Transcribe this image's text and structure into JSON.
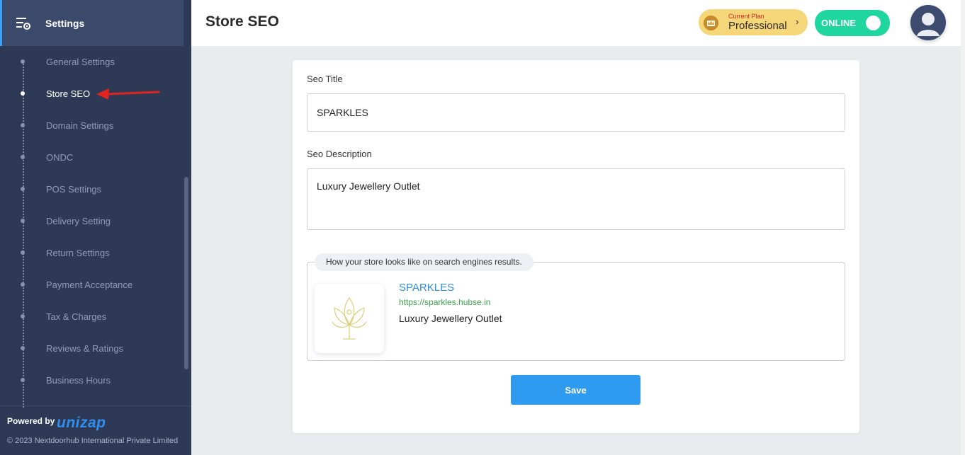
{
  "sidebar": {
    "title": "Settings",
    "items": [
      {
        "label": "General Settings"
      },
      {
        "label": "Store SEO"
      },
      {
        "label": "Domain Settings"
      },
      {
        "label": "ONDC"
      },
      {
        "label": "POS Settings"
      },
      {
        "label": "Delivery Setting"
      },
      {
        "label": "Return Settings"
      },
      {
        "label": "Payment Acceptance"
      },
      {
        "label": "Tax & Charges"
      },
      {
        "label": "Reviews & Ratings"
      },
      {
        "label": "Business Hours"
      }
    ],
    "active_item": "Store SEO",
    "footer": {
      "powered_by": "Powered by",
      "brand": "unizap",
      "copyright": "© 2023 Nextdoorhub International Private Limited"
    }
  },
  "header": {
    "page_title": "Store SEO",
    "plan_label": "Current Plan",
    "plan_value": "Professional",
    "status": "ONLINE"
  },
  "form": {
    "seo_title_label": "Seo Title",
    "seo_title_value": "SPARKLES",
    "seo_description_label": "Seo Description",
    "seo_description_value": "Luxury Jewellery Outlet"
  },
  "preview": {
    "caption": "How your store looks like on search engines results.",
    "title": "SPARKLES",
    "url": "https://sparkles.hubse.in",
    "description": "Luxury Jewellery Outlet"
  },
  "actions": {
    "save_label": "Save"
  },
  "colors": {
    "sidebar_bg": "#2e3a55",
    "accent": "#2f9bf0",
    "online": "#1fd69e",
    "plan": "#f5d77a",
    "annotation_arrow": "#e0241e"
  }
}
